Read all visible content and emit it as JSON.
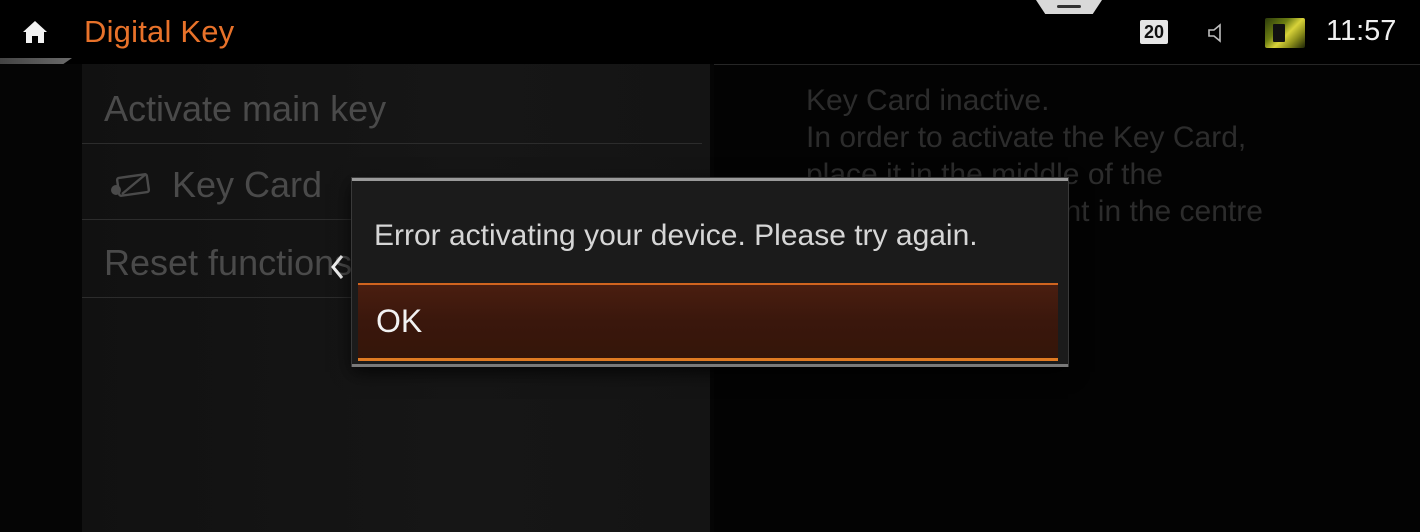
{
  "header": {
    "title": "Digital Key",
    "speed_limit": "20",
    "clock": "11:57",
    "icons": {
      "home": "home-icon",
      "speaker": "speaker-icon",
      "media": "media-thumbnail-icon"
    }
  },
  "menu": {
    "items": [
      {
        "label": "Activate main key"
      },
      {
        "label": "Key Card",
        "icon": "key-card-icon"
      },
      {
        "label": "Reset functions"
      }
    ]
  },
  "info": {
    "lines": [
      "Key Card inactive.",
      "In order to activate the Key Card,",
      "place it in the middle of the",
      "storage compartment in the centre"
    ]
  },
  "dialog": {
    "message": "Error activating your device. Please try again.",
    "ok_label": "OK"
  },
  "colors": {
    "accent": "#e8722a",
    "background": "#000000",
    "dialog_button": "#3a170c"
  }
}
